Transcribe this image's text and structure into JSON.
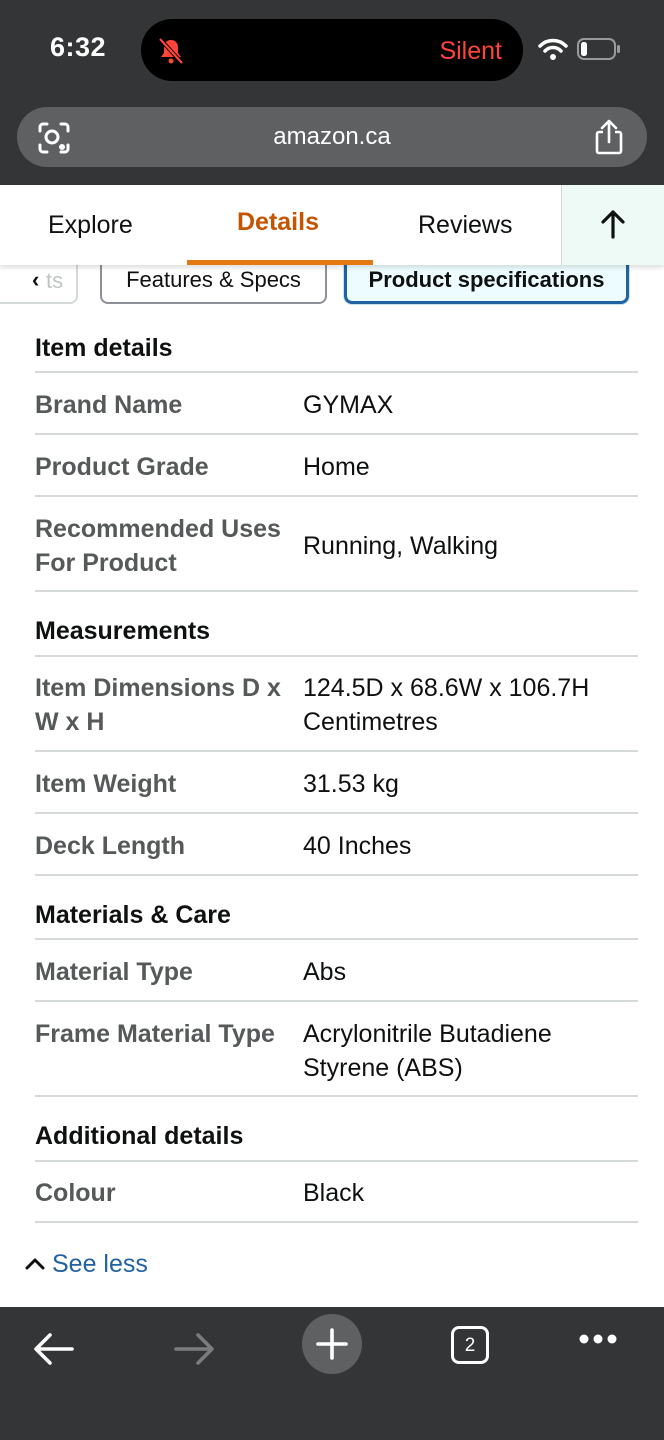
{
  "status_bar": {
    "time": "6:32",
    "mode_label": "Silent"
  },
  "browser": {
    "url": "amazon.ca",
    "tab_count": "2"
  },
  "nav_tabs": {
    "explore": "Explore",
    "details": "Details",
    "reviews": "Reviews",
    "active": "Details"
  },
  "chips": {
    "previous_partial": "ts",
    "features": "Features & Specs",
    "specs": "Product specifications",
    "selected": "Product specifications"
  },
  "sections": [
    {
      "title": "Item details",
      "rows": [
        {
          "label": "Brand Name",
          "value": "GYMAX"
        },
        {
          "label": "Product Grade",
          "value": "Home"
        },
        {
          "label": "Recommended Uses For Product",
          "value": "Running, Walking"
        }
      ]
    },
    {
      "title": "Measurements",
      "rows": [
        {
          "label": "Item Dimensions D x W x H",
          "value": "124.5D x 68.6W x 106.7H Centimetres"
        },
        {
          "label": "Item Weight",
          "value": "31.53 kg"
        },
        {
          "label": "Deck Length",
          "value": "40 Inches"
        }
      ]
    },
    {
      "title": "Materials & Care",
      "rows": [
        {
          "label": "Material Type",
          "value": "Abs"
        },
        {
          "label": "Frame Material Type",
          "value": "Acrylonitrile Butadiene Styrene (ABS)"
        }
      ]
    },
    {
      "title": "Additional details",
      "rows": [
        {
          "label": "Colour",
          "value": "Black"
        }
      ]
    }
  ],
  "see_less": "See less",
  "icons": {
    "status": [
      "bell-slash-icon",
      "wifi-icon",
      "battery-icon"
    ],
    "url_bar": [
      "visual-search-icon",
      "share-icon"
    ],
    "tab_bar": [
      "arrow-up-icon"
    ],
    "toolbar": [
      "back-arrow-icon",
      "forward-arrow-icon",
      "plus-icon",
      "tabs-icon",
      "more-icon"
    ],
    "see_less": "chevron-up-icon"
  },
  "colors": {
    "chrome": "#333536",
    "active_tab": "#c45500",
    "tab_underline": "#e47911",
    "link": "#2162a1",
    "silent": "#ff453a",
    "label_gray": "#565959"
  }
}
